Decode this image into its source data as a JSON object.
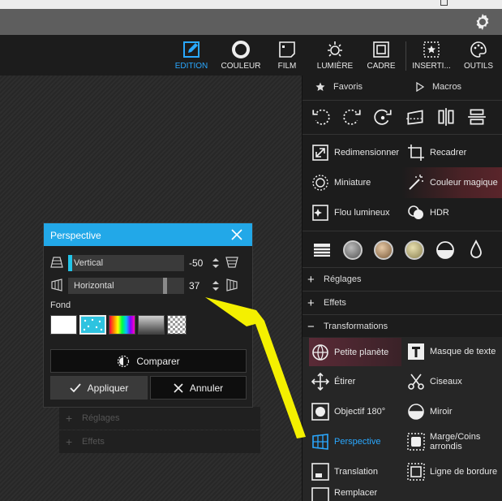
{
  "tabs": [
    {
      "label": "EDITION",
      "icon": "edit-icon",
      "active": true
    },
    {
      "label": "COULEUR",
      "icon": "circle-ring-icon"
    },
    {
      "label": "FILM",
      "icon": "film-icon"
    },
    {
      "label": "LUMIÈRE",
      "icon": "sun-icon"
    },
    {
      "label": "CADRE",
      "icon": "frame-icon"
    },
    {
      "label": "INSERTI...",
      "icon": "insert-star-icon"
    },
    {
      "label": "OUTILS",
      "icon": "palette-icon"
    }
  ],
  "panel": {
    "favoris": "Favoris",
    "macros": "Macros",
    "tools_top": [
      {
        "label": "Redimensionner",
        "icon": "resize-icon"
      },
      {
        "label": "Recadrer",
        "icon": "crop-icon"
      },
      {
        "label": "Miniature",
        "icon": "miniature-icon"
      },
      {
        "label": "Couleur magique",
        "icon": "magic-wand-icon"
      },
      {
        "label": "Flou lumineux",
        "icon": "glow-icon"
      },
      {
        "label": "HDR",
        "icon": "hdr-icon"
      }
    ],
    "sections": {
      "reglages": "Réglages",
      "effets": "Effets",
      "transformations": "Transformations"
    },
    "tools_transform": [
      {
        "label": "Petite planète",
        "icon": "globe-icon"
      },
      {
        "label": "Masque de texte",
        "icon": "text-mask-icon"
      },
      {
        "label": "Étirer",
        "icon": "stretch-icon"
      },
      {
        "label": "Ciseaux",
        "icon": "scissors-icon"
      },
      {
        "label": "Objectif 180°",
        "icon": "fisheye-icon"
      },
      {
        "label": "Miroir",
        "icon": "mirror-icon"
      },
      {
        "label": "Perspective",
        "icon": "perspective-grid-icon"
      },
      {
        "label": "Marge/Coins arrondis",
        "icon": "rounded-corners-icon"
      },
      {
        "label": "Translation",
        "icon": "translation-icon"
      },
      {
        "label": "Ligne de bordure",
        "icon": "border-line-icon"
      },
      {
        "label": "Remplacer",
        "icon": "replace-icon"
      }
    ]
  },
  "ghost": {
    "reglages": "Réglages",
    "effets": "Effets"
  },
  "dialog": {
    "title": "Perspective",
    "vertical": {
      "label": "Vertical",
      "value": "-50",
      "fraction": 0.0,
      "fill_color": "#22c4e8"
    },
    "horizontal": {
      "label": "Horizontal",
      "value": "37",
      "fraction": 0.85,
      "fill_color": "#8a8a8a"
    },
    "fond_label": "Fond",
    "compare_label": "Comparer",
    "apply_label": "Appliquer",
    "cancel_label": "Annuler"
  },
  "colors": {
    "accent": "#22a8e8",
    "annotation_arrow": "#f4f000"
  }
}
